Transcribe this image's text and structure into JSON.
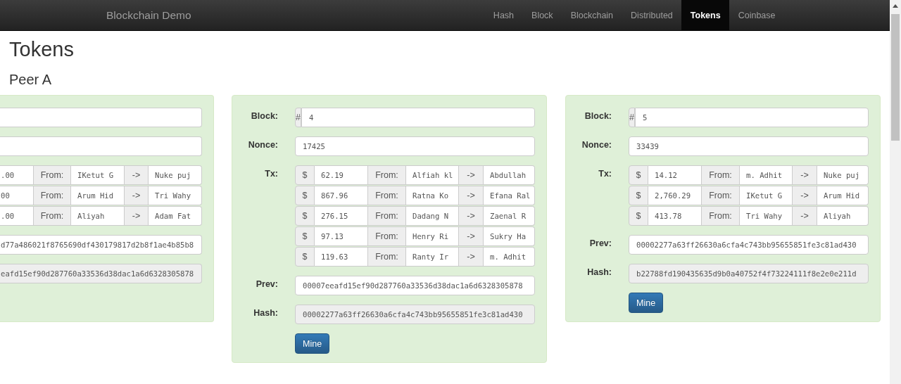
{
  "navbar": {
    "brand": "Blockchain Demo",
    "items": [
      {
        "label": "Hash",
        "selected": false
      },
      {
        "label": "Block",
        "selected": false
      },
      {
        "label": "Blockchain",
        "selected": false
      },
      {
        "label": "Distributed",
        "selected": false
      },
      {
        "label": "Tokens",
        "selected": true
      },
      {
        "label": "Coinbase",
        "selected": false
      }
    ]
  },
  "heading": "Tokens",
  "peer": "Peer A",
  "cards": [
    {
      "kind": "partial",
      "transactions": [
        {
          "amount": ".00",
          "from_label": "From:",
          "from": "IKetut G",
          "arrow": "->",
          "to": "Nuke puj"
        },
        {
          "amount": "00",
          "from_label": "From:",
          "from": "Arum Hid",
          "arrow": "->",
          "to": "Tri Wahy"
        },
        {
          "amount": ".00",
          "from_label": "From:",
          "from": "Aliyah",
          "arrow": "->",
          "to": "Adam Fat"
        }
      ],
      "prev": "d77a486021f8765690df430179817d2b8f1ae4b85b8",
      "hash": "eafd15ef90d287760a33536d38dac1a6d6328305878"
    },
    {
      "kind": "full",
      "block_label": "Block:",
      "block_prefix": "#",
      "block": "4",
      "nonce_label": "Nonce:",
      "nonce": "17425",
      "tx_label": "Tx:",
      "transactions": [
        {
          "currency": "$",
          "amount": "62.19",
          "from_label": "From:",
          "from": "Alfiah kl",
          "arrow": "->",
          "to": "Abdullah"
        },
        {
          "currency": "$",
          "amount": "867.96",
          "from_label": "From:",
          "from": "Ratna Ko",
          "arrow": "->",
          "to": "Efana Ral"
        },
        {
          "currency": "$",
          "amount": "276.15",
          "from_label": "From:",
          "from": "Dadang N",
          "arrow": "->",
          "to": "Zaenal R"
        },
        {
          "currency": "$",
          "amount": "97.13",
          "from_label": "From:",
          "from": "Henry Ri",
          "arrow": "->",
          "to": "Sukry Ha"
        },
        {
          "currency": "$",
          "amount": "119.63",
          "from_label": "From:",
          "from": "Ranty Ir",
          "arrow": "->",
          "to": "m. Adhit"
        }
      ],
      "prev_label": "Prev:",
      "prev": "00007eeafd15ef90d287760a33536d38dac1a6d6328305878",
      "hash_label": "Hash:",
      "hash": "00002277a63ff26630a6cfa4c743bb95655851fe3c81ad430",
      "button": "Mine"
    },
    {
      "kind": "full",
      "block_label": "Block:",
      "block_prefix": "#",
      "block": "5",
      "nonce_label": "Nonce:",
      "nonce": "33439",
      "tx_label": "Tx:",
      "transactions": [
        {
          "currency": "$",
          "amount": "14.12",
          "from_label": "From:",
          "from": "m. Adhit",
          "arrow": "->",
          "to": "Nuke puj"
        },
        {
          "currency": "$",
          "amount": "2,760.29",
          "from_label": "From:",
          "from": "IKetut G",
          "arrow": "->",
          "to": "Arum Hid"
        },
        {
          "currency": "$",
          "amount": "413.78",
          "from_label": "From:",
          "from": "Tri Wahy",
          "arrow": "->",
          "to": "Aliyah"
        }
      ],
      "prev_label": "Prev:",
      "prev": "00002277a63ff26630a6cfa4c743bb95655851fe3c81ad430",
      "hash_label": "Hash:",
      "hash": "b22788fd190435635d9b0a40752f4f73224111f8e2e0e211d",
      "button": "Mine"
    }
  ]
}
